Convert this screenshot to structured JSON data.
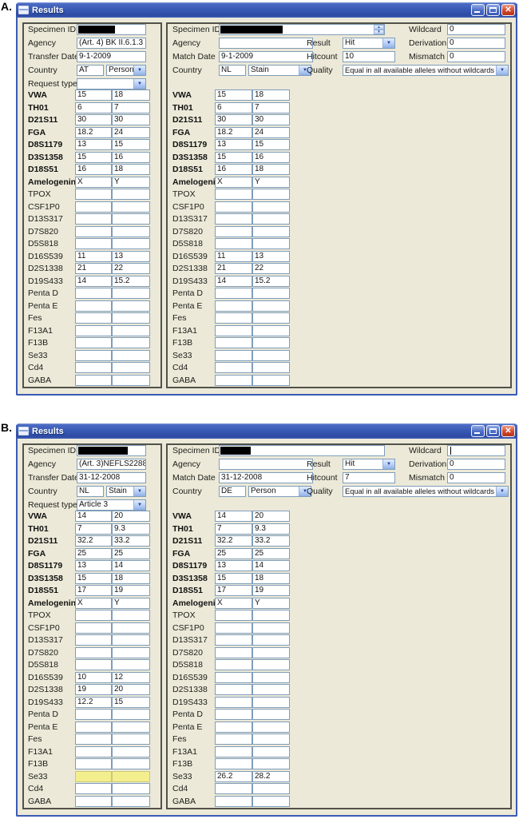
{
  "field_labels": {
    "specimen_id": "Specimen ID",
    "agency": "Agency",
    "country": "Country",
    "request_type": "Request type",
    "result": "Result",
    "hitcount": "Hitcount",
    "quality": "Quality",
    "wildcard": "Wildcard",
    "derivation": "Derivation",
    "mismatch": "Mismatch"
  },
  "markers": [
    "VWA",
    "TH01",
    "D21S11",
    "FGA",
    "D8S1179",
    "D3S1358",
    "D18S51",
    "Amelogenin",
    "TPOX",
    "CSF1P0",
    "D13S317",
    "D7S820",
    "D5S818",
    "D16S539",
    "D2S1338",
    "D19S433",
    "Penta D",
    "Penta E",
    "Fes",
    "F13A1",
    "F13B",
    "Se33",
    "Cd4",
    "GABA"
  ],
  "bold_marker_count": 8,
  "colors": {
    "titlebar_blue": "#3A5BB5",
    "close_red": "#C9482E",
    "content_beige": "#ECE9D8",
    "field_border": "#7F9DB9",
    "highlight_yellow": "#F3EF8E"
  },
  "windows": [
    {
      "id": "a",
      "figure_label": "A.",
      "title": "Results",
      "left_panel": {
        "specimen_id_redacted": true,
        "redact_width": 46,
        "agency": "(Art. 4) BK II.6.1.3",
        "date_label": "Transfer Date",
        "date": "9-1-2009",
        "country_code": "AT",
        "country_type": "Person",
        "request_type": "",
        "highlight_marker": "",
        "alleles": [
          [
            "15",
            "18"
          ],
          [
            "6",
            "7"
          ],
          [
            "30",
            "30"
          ],
          [
            "18.2",
            "24"
          ],
          [
            "13",
            "15"
          ],
          [
            "15",
            "16"
          ],
          [
            "16",
            "18"
          ],
          [
            "X",
            "Y"
          ],
          [
            "",
            ""
          ],
          [
            "",
            ""
          ],
          [
            "",
            ""
          ],
          [
            "",
            ""
          ],
          [
            "",
            ""
          ],
          [
            "11",
            "13"
          ],
          [
            "21",
            "22"
          ],
          [
            "14",
            "15.2"
          ],
          [
            "",
            ""
          ],
          [
            "",
            ""
          ],
          [
            "",
            ""
          ],
          [
            "",
            ""
          ],
          [
            "",
            ""
          ],
          [
            "",
            ""
          ],
          [
            "",
            ""
          ],
          [
            "",
            ""
          ]
        ]
      },
      "right_panel": {
        "specimen_id_redacted": true,
        "redact_width": 78,
        "has_spinner": true,
        "agency": "",
        "date_label": "Match Date",
        "date": "9-1-2009",
        "country_code": "NL",
        "country_type": "Stain",
        "result": "Hit",
        "hitcount": "10",
        "quality": "Equal in all available alleles without wildcards",
        "wildcard": "0",
        "wildcard_cursor": false,
        "derivation": "0",
        "mismatch": "0",
        "highlight_marker": "",
        "alleles": [
          [
            "15",
            "18"
          ],
          [
            "6",
            "7"
          ],
          [
            "30",
            "30"
          ],
          [
            "18.2",
            "24"
          ],
          [
            "13",
            "15"
          ],
          [
            "15",
            "16"
          ],
          [
            "16",
            "18"
          ],
          [
            "X",
            "Y"
          ],
          [
            "",
            ""
          ],
          [
            "",
            ""
          ],
          [
            "",
            ""
          ],
          [
            "",
            ""
          ],
          [
            "",
            ""
          ],
          [
            "11",
            "13"
          ],
          [
            "21",
            "22"
          ],
          [
            "14",
            "15.2"
          ],
          [
            "",
            ""
          ],
          [
            "",
            ""
          ],
          [
            "",
            ""
          ],
          [
            "",
            ""
          ],
          [
            "",
            ""
          ],
          [
            "",
            ""
          ],
          [
            "",
            ""
          ],
          [
            "",
            ""
          ]
        ]
      }
    },
    {
      "id": "b",
      "figure_label": "B.",
      "title": "Results",
      "left_panel": {
        "specimen_id_redacted": true,
        "redact_width": 62,
        "agency": "(Art. 3)NEFLS2288",
        "date_label": "Transfer Date",
        "date": "31-12-2008",
        "country_code": "NL",
        "country_type": "Stain",
        "request_type": "Article 3",
        "highlight_marker": "Se33",
        "alleles": [
          [
            "14",
            "20"
          ],
          [
            "7",
            "9.3"
          ],
          [
            "32.2",
            "33.2"
          ],
          [
            "25",
            "25"
          ],
          [
            "13",
            "14"
          ],
          [
            "15",
            "18"
          ],
          [
            "17",
            "19"
          ],
          [
            "X",
            "Y"
          ],
          [
            "",
            ""
          ],
          [
            "",
            ""
          ],
          [
            "",
            ""
          ],
          [
            "",
            ""
          ],
          [
            "",
            ""
          ],
          [
            "10",
            "12"
          ],
          [
            "19",
            "20"
          ],
          [
            "12.2",
            "15"
          ],
          [
            "",
            ""
          ],
          [
            "",
            ""
          ],
          [
            "",
            ""
          ],
          [
            "",
            ""
          ],
          [
            "",
            ""
          ],
          [
            "",
            ""
          ],
          [
            "",
            ""
          ],
          [
            "",
            ""
          ]
        ]
      },
      "right_panel": {
        "specimen_id_redacted": true,
        "redact_width": 38,
        "has_spinner": false,
        "agency": "",
        "date_label": "Match Date",
        "date": "31-12-2008",
        "country_code": "DE",
        "country_type": "Person",
        "result": "Hit",
        "hitcount": "7",
        "quality": "Equal in all available alleles without wildcards",
        "wildcard": "",
        "wildcard_cursor": true,
        "derivation": "0",
        "mismatch": "0",
        "highlight_marker": "",
        "alleles": [
          [
            "14",
            "20"
          ],
          [
            "7",
            "9.3"
          ],
          [
            "32.2",
            "33.2"
          ],
          [
            "25",
            "25"
          ],
          [
            "13",
            "14"
          ],
          [
            "15",
            "18"
          ],
          [
            "17",
            "19"
          ],
          [
            "X",
            "Y"
          ],
          [
            "",
            ""
          ],
          [
            "",
            ""
          ],
          [
            "",
            ""
          ],
          [
            "",
            ""
          ],
          [
            "",
            ""
          ],
          [
            "",
            ""
          ],
          [
            "",
            ""
          ],
          [
            "",
            ""
          ],
          [
            "",
            ""
          ],
          [
            "",
            ""
          ],
          [
            "",
            ""
          ],
          [
            "",
            ""
          ],
          [
            "",
            ""
          ],
          [
            "26.2",
            "28.2"
          ],
          [
            "",
            ""
          ],
          [
            "",
            ""
          ]
        ]
      }
    }
  ]
}
